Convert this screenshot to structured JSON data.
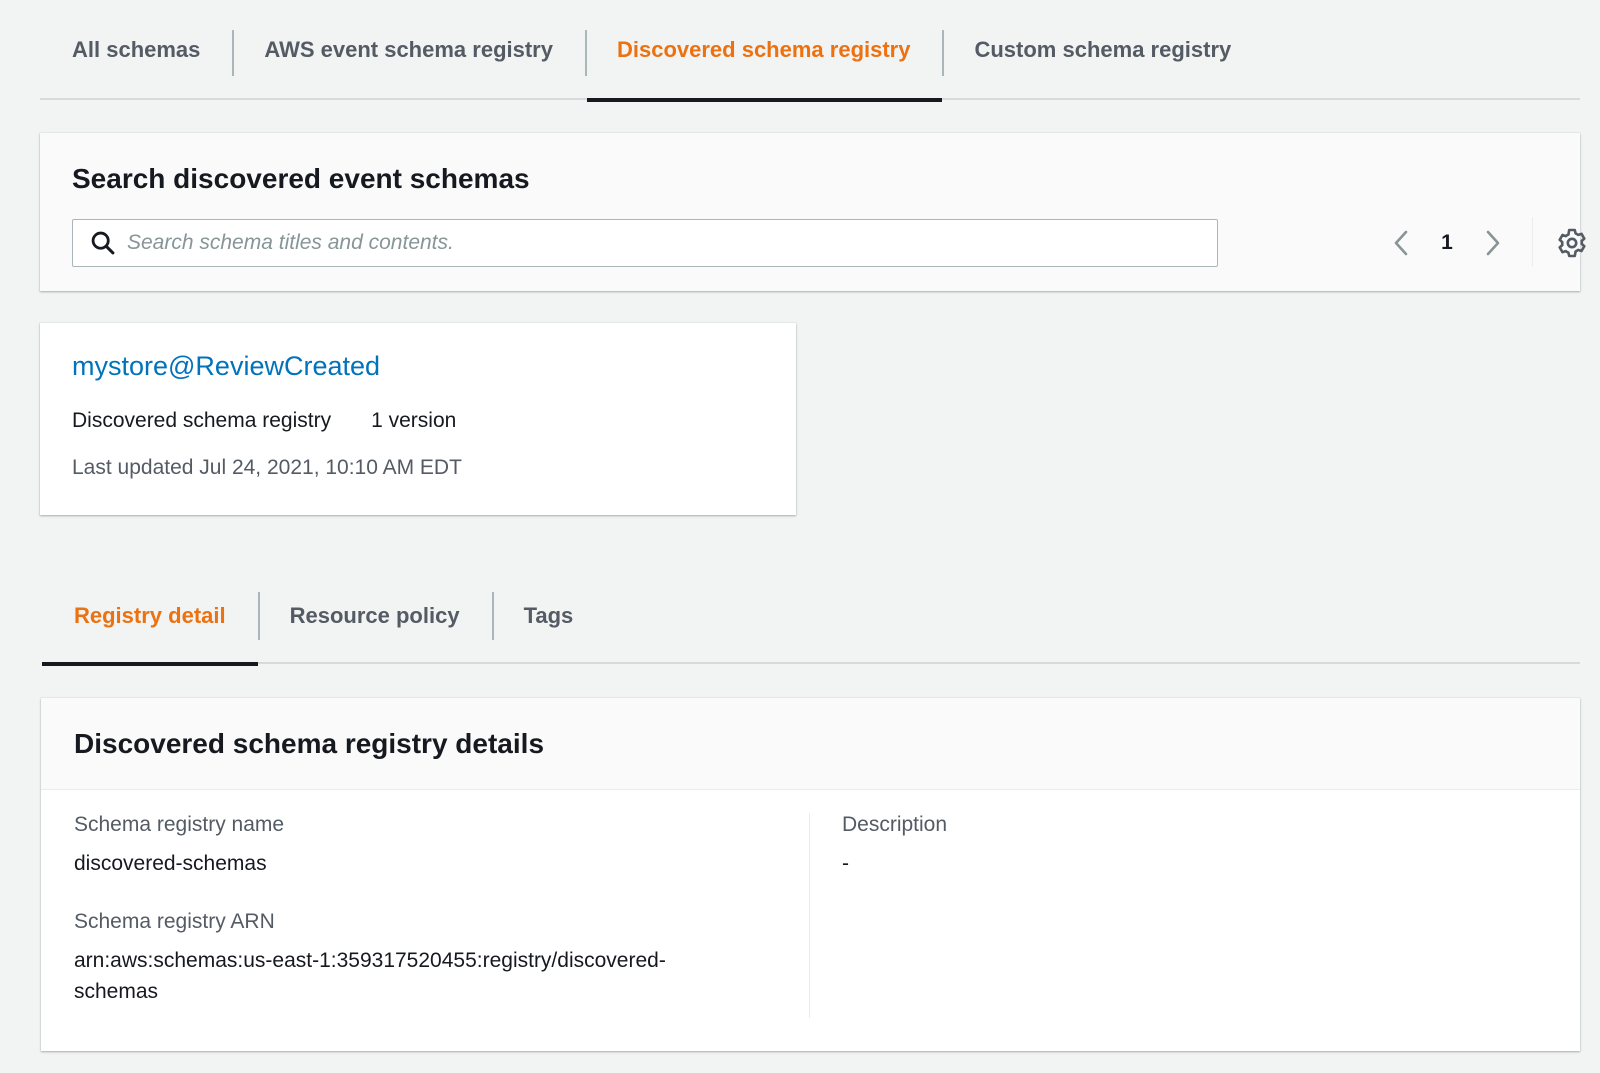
{
  "top_tabs": [
    {
      "label": "All schemas",
      "active": false
    },
    {
      "label": "AWS event schema registry",
      "active": false
    },
    {
      "label": "Discovered schema registry",
      "active": true
    },
    {
      "label": "Custom schema registry",
      "active": false
    }
  ],
  "search": {
    "title": "Search discovered event schemas",
    "placeholder": "Search schema titles and contents.",
    "value": ""
  },
  "pagination": {
    "current_page": "1",
    "prev_icon": "chevron-left-icon",
    "next_icon": "chevron-right-icon"
  },
  "settings_icon": "gear-icon",
  "schema_card": {
    "name": "mystore@ReviewCreated",
    "registry": "Discovered schema registry",
    "versions": "1 version",
    "last_updated": "Last updated Jul 24, 2021, 10:10 AM EDT"
  },
  "detail_tabs": [
    {
      "label": "Registry detail",
      "active": true
    },
    {
      "label": "Resource policy",
      "active": false
    },
    {
      "label": "Tags",
      "active": false
    }
  ],
  "details": {
    "title": "Discovered schema registry details",
    "registry_name_label": "Schema registry name",
    "registry_name_value": "discovered-schemas",
    "registry_arn_label": "Schema registry ARN",
    "registry_arn_value": "arn:aws:schemas:us-east-1:359317520455:registry/discovered-schemas",
    "description_label": "Description",
    "description_value": "-"
  },
  "colors": {
    "active_tab": "#ec7211",
    "link": "#0073bb",
    "text": "#16191f",
    "muted": "#545b64",
    "background": "#f2f3f3"
  }
}
